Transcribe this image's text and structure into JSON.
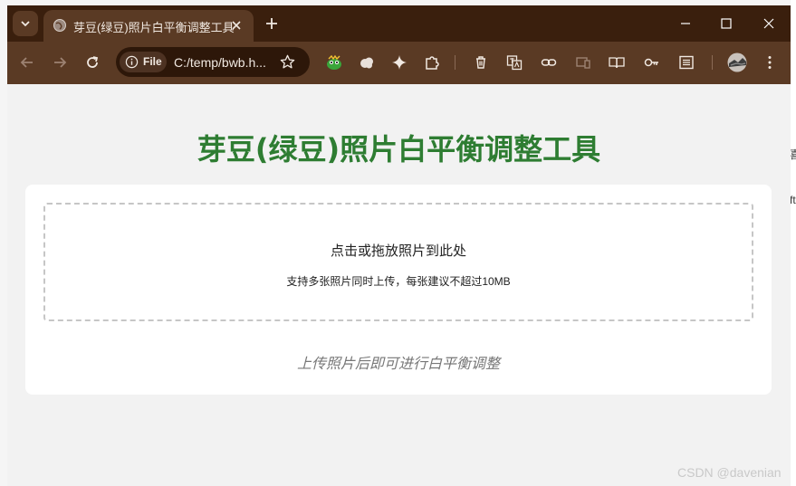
{
  "browser": {
    "tab_title": "芽豆(绿豆)照片白平衡调整工具",
    "omnibox": {
      "chip_label": "File",
      "url": "C:/temp/bwb.h..."
    },
    "toolbar_icons": [
      "back-icon",
      "forward-icon",
      "reload-icon",
      "info-icon",
      "star-icon",
      "extension-mascot-icon",
      "cloud-icon",
      "sparkle-icon",
      "puzzle-icon",
      "trash-icon",
      "translate-icon",
      "link-icon",
      "device-icon",
      "reader-icon",
      "key-icon",
      "sidepanel-icon",
      "avatar",
      "menu-icon"
    ]
  },
  "page": {
    "title": "芽豆(绿豆)照片白平衡调整工具",
    "dropzone": {
      "main_text": "点击或拖放照片到此处",
      "sub_text": "支持多张照片同时上传，每张建议不超过10MB"
    },
    "hint": "上传照片后即可进行白平衡调整"
  },
  "background": {
    "fragment_1": "喜",
    "fragment_2": "ft"
  },
  "watermark": "CSDN @davenian",
  "colors": {
    "title_green": "#2e7d32",
    "chrome_dark": "#3a1f0d",
    "chrome_toolbar": "#5a3a24"
  }
}
